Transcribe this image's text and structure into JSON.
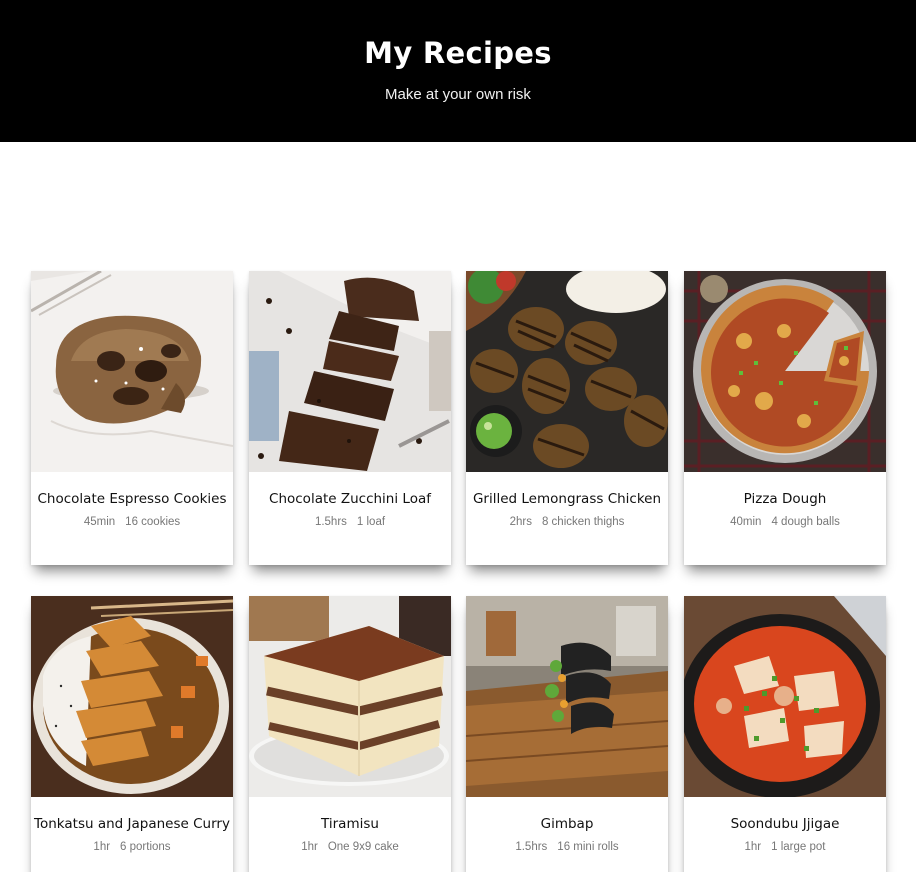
{
  "header": {
    "title": "My Recipes",
    "subtitle": "Make at your own risk"
  },
  "recipes": [
    {
      "title": "Chocolate Espresso Cookies",
      "time": "45min",
      "yield": "16 cookies",
      "image_icon": "cookie-photo"
    },
    {
      "title": "Chocolate Zucchini Loaf",
      "time": "1.5hrs",
      "yield": "1 loaf",
      "image_icon": "loaf-photo"
    },
    {
      "title": "Grilled Lemongrass Chicken",
      "time": "2hrs",
      "yield": "8 chicken thighs",
      "image_icon": "chicken-photo"
    },
    {
      "title": "Pizza Dough",
      "time": "40min",
      "yield": "4 dough balls",
      "image_icon": "pizza-photo"
    },
    {
      "title": "Tonkatsu and Japanese Curry",
      "time": "1hr",
      "yield": "6 portions",
      "image_icon": "curry-photo"
    },
    {
      "title": "Tiramisu",
      "time": "1hr",
      "yield": "One 9x9 cake",
      "image_icon": "tiramisu-photo"
    },
    {
      "title": "Gimbap",
      "time": "1.5hrs",
      "yield": "16 mini rolls",
      "image_icon": "gimbap-photo"
    },
    {
      "title": "Soondubu Jjigae",
      "time": "1hr",
      "yield": "1 large pot",
      "image_icon": "stew-photo"
    }
  ],
  "colors": {
    "header_bg": "#000000",
    "header_text": "#ffffff",
    "meta_text": "#777777"
  }
}
